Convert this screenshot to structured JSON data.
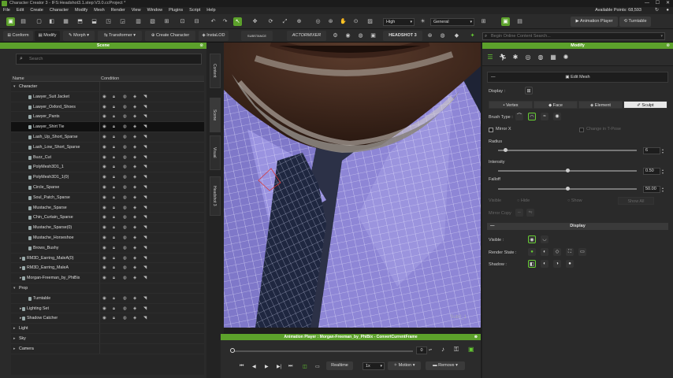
{
  "window": {
    "title": "Character Creator 3 - IFS:Headshot3.1.step:V3.0.ccProject *",
    "available_points": "Available Points: 68,593"
  },
  "menu": [
    "File",
    "Edit",
    "Create",
    "Character",
    "Modify",
    "Mesh",
    "Render",
    "View",
    "Window",
    "Plugins",
    "Script",
    "Help"
  ],
  "toolbar": {
    "quality": "High",
    "mode": "General",
    "animation_player": "Animation Player",
    "turntable": "Turntable",
    "conform": "Conform",
    "modify": "Modify",
    "morph": "Morph",
    "transformer": "Transformer",
    "create_character": "Create Character",
    "instalod": "InstaLOD",
    "substance": "SUBSTANCE",
    "actormixer": "ACTORMIXER",
    "headshot": "HEADSHOT",
    "search_placeholder": "Begin Online Content Search..."
  },
  "scene": {
    "title": "Scene",
    "search_placeholder": "Search",
    "col_name": "Name",
    "col_condition": "Condition",
    "rows": [
      {
        "name": "Character",
        "level": 0,
        "cat": true
      },
      {
        "name": "Lawyer_Suit Jacket",
        "level": 2
      },
      {
        "name": "Lawyer_Oxford_Shoes",
        "level": 2
      },
      {
        "name": "Lawyer_Pants",
        "level": 2
      },
      {
        "name": "Lawyer_Shirt Tie",
        "level": 2,
        "selected": true
      },
      {
        "name": "Lash_Up_Short_Sparse",
        "level": 2
      },
      {
        "name": "Lash_Low_Short_Sparse",
        "level": 2
      },
      {
        "name": "Buzz_Cut",
        "level": 2
      },
      {
        "name": "PolyMesh3D1_1",
        "level": 2
      },
      {
        "name": "PolyMesh3D1_1(0)",
        "level": 2
      },
      {
        "name": "Circle_Sparse",
        "level": 2
      },
      {
        "name": "Soul_Patch_Sparse",
        "level": 2
      },
      {
        "name": "Mustache_Sparse",
        "level": 2
      },
      {
        "name": "Chin_Curtain_Sparse",
        "level": 2
      },
      {
        "name": "Mustache_Sparse(0)",
        "level": 2
      },
      {
        "name": "Mustache_Horseshoe",
        "level": 2
      },
      {
        "name": "Brows_Bushy",
        "level": 2
      },
      {
        "name": "RM3D_Earring_MaleA(0)",
        "level": 1,
        "exp": true
      },
      {
        "name": "RM3D_Earring_MaleA",
        "level": 1,
        "exp": true
      },
      {
        "name": "Morgan-Freeman_by_PhiBix",
        "level": 1,
        "exp": true
      },
      {
        "name": "Prop",
        "level": 0,
        "cat": true
      },
      {
        "name": "Turntable",
        "level": 2
      },
      {
        "name": "Lighting Set",
        "level": 1,
        "exp": true
      },
      {
        "name": "Shadow Catcher",
        "level": 1,
        "exp": true
      },
      {
        "name": "Light",
        "level": 0,
        "cat": true,
        "collapsed": true
      },
      {
        "name": "Sky",
        "level": 0,
        "cat": true,
        "collapsed": true
      },
      {
        "name": "Camera",
        "level": 0,
        "cat": true,
        "collapsed": true
      }
    ]
  },
  "side_tabs": [
    "Content",
    "Scene",
    "Visual",
    "Headshot 3"
  ],
  "viewport": {
    "watermark": "Sub0_1"
  },
  "anim_player": {
    "title": "Animation Player : Morgan-Freeman_by_PhiBix - ConvertCurrentFrame",
    "frame": "0",
    "realtime": "Realtime",
    "speed": "1x",
    "motion": "Motion",
    "remove": "Remove"
  },
  "modify": {
    "title": "Modify",
    "edit_mesh": "Edit Mesh",
    "display_label": "Display :",
    "segments": [
      "Vertex",
      "Face",
      "Element",
      "Sculpt"
    ],
    "brush_type": "Brush Type :",
    "mirror_x": "Mirror X",
    "change_in_tpose": "Change in T-Pose",
    "radius_label": "Radius",
    "radius_value": "6",
    "intensity_label": "Intensity",
    "intensity_value": "0.50",
    "falloff_label": "Falloff",
    "falloff_value": "50.00",
    "visible_label": "Visible",
    "hide_label": "Hide",
    "show_label": "Show",
    "show_all": "Show All",
    "mirror_copy": "Mirror Copy",
    "display_section": "Display",
    "visible2": "Visible :",
    "render_state": "Render State :",
    "shadow": "Shadow :",
    "slider_levels": {
      "radius": 0.05,
      "intensity": 0.5,
      "falloff": 0.5
    }
  },
  "colors": {
    "accent": "#5ca12b",
    "shirt": "#7f78c9",
    "tie": "#1f2740"
  }
}
